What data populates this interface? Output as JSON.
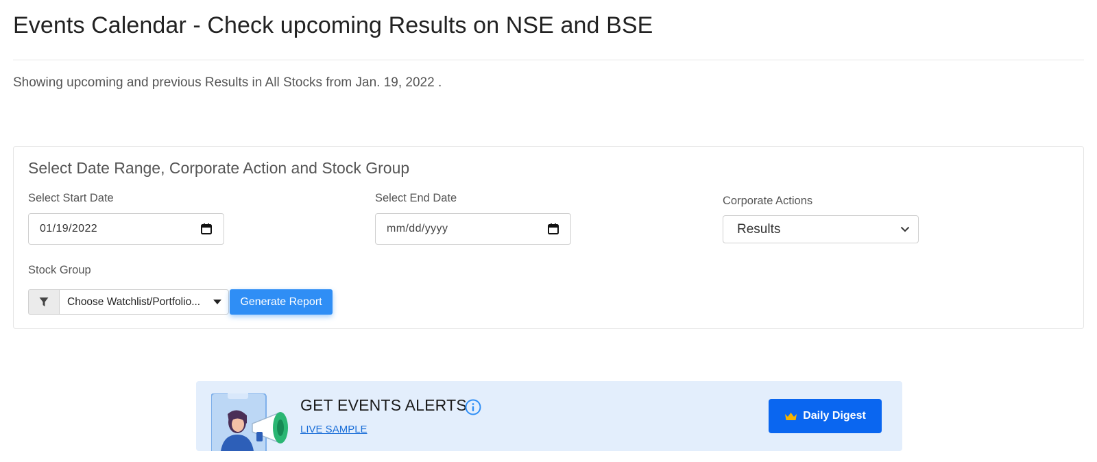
{
  "header": {
    "title": "Events Calendar - Check upcoming Results on NSE and BSE",
    "subtitle": "Showing upcoming and previous Results in All Stocks from Jan. 19, 2022 ."
  },
  "filters": {
    "heading": "Select Date Range, Corporate Action and Stock Group",
    "start_date": {
      "label": "Select Start Date",
      "value": "01/19/2022",
      "icon": "calendar-icon"
    },
    "end_date": {
      "label": "Select End Date",
      "placeholder": "mm/dd/yyyy",
      "icon": "calendar-icon"
    },
    "corporate_actions": {
      "label": "Corporate Actions",
      "selected": "Results",
      "icon": "chevron-down-icon"
    },
    "stock_group": {
      "label": "Stock Group",
      "filter_icon": "filter-icon",
      "selected": "Choose Watchlist/Portfolio...",
      "generate_label": "Generate Report"
    }
  },
  "alerts": {
    "title": "GET EVENTS ALERTS",
    "info_icon": "info-icon",
    "live_sample": "LIVE SAMPLE",
    "digest_label": "Daily Digest",
    "digest_icon": "crown-icon",
    "colors": {
      "banner_bg": "#e3eefc",
      "button_bg": "#0a66f0",
      "crown": "#f5b300"
    }
  },
  "colors": {
    "primary_button": "#2f8ef5",
    "link": "#1a6ed8"
  }
}
